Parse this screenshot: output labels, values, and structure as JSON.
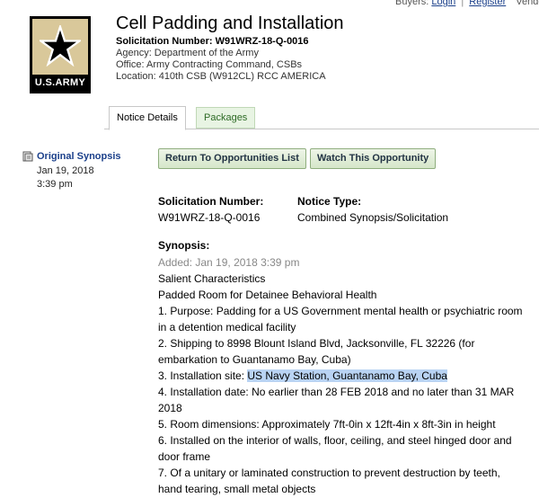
{
  "topbar": {
    "buyers_label": "Buyers:",
    "login": "Login",
    "separator": "|",
    "register": "Register",
    "vendors_label": "Vendo"
  },
  "logo": {
    "text": "U.S.ARMY"
  },
  "header": {
    "title": "Cell Padding and Installation",
    "solicitation_number_label": "Solicitation Number:",
    "solicitation_number": "W91WRZ-18-Q-0016",
    "agency": "Agency: Department of the Army",
    "office": "Office: Army Contracting Command, CSBs",
    "location": "Location: 410th CSB (W912CL) RCC AMERICA"
  },
  "tabs": [
    {
      "label": "Notice Details",
      "active": true
    },
    {
      "label": "Packages",
      "active": false
    }
  ],
  "sidebar": {
    "link": "Original Synopsis",
    "date": "Jan 19, 2018",
    "time": "3:39 pm"
  },
  "buttons": {
    "return": "Return To Opportunities List",
    "watch": "Watch This Opportunity"
  },
  "notice": {
    "solicitation_label": "Solicitation Number:",
    "solicitation_value": "W91WRZ-18-Q-0016",
    "type_label": "Notice Type:",
    "type_value": "Combined Synopsis/Solicitation",
    "synopsis_label": "Synopsis:",
    "added": "Added: Jan 19, 2018 3:39 pm",
    "line1": "Salient Characteristics",
    "line2": "Padded Room for Detainee Behavioral Health",
    "item1": "1. Purpose: Padding for a US Government mental health or psychiatric room in a detention medical facility",
    "item2": "2. Shipping to 8998 Blount Island Blvd, Jacksonville, FL 32226 (for embarkation to Guantanamo Bay, Cuba)",
    "item3_prefix": "3. Installation site: ",
    "item3_highlight": "US Navy Station, Guantanamo Bay, Cuba",
    "item4": "4. Installation date: No earlier than 28 FEB 2018 and no later than 31 MAR 2018",
    "item5": "5. Room dimensions: Approximately 7ft-0in x 12ft-4in x 8ft-3in in height",
    "item6": "6. Installed on the interior of walls, floor, ceiling, and steel hinged door and door frame",
    "item7": "7. Of a unitary or laminated construction to prevent destruction by teeth, hand tearing, small metal objects"
  },
  "colors": {
    "link": "#1a3f8a",
    "tab_inactive_bg": "#e8f4e3",
    "button_border": "#8fae7e",
    "highlight": "#b9d3f3"
  }
}
